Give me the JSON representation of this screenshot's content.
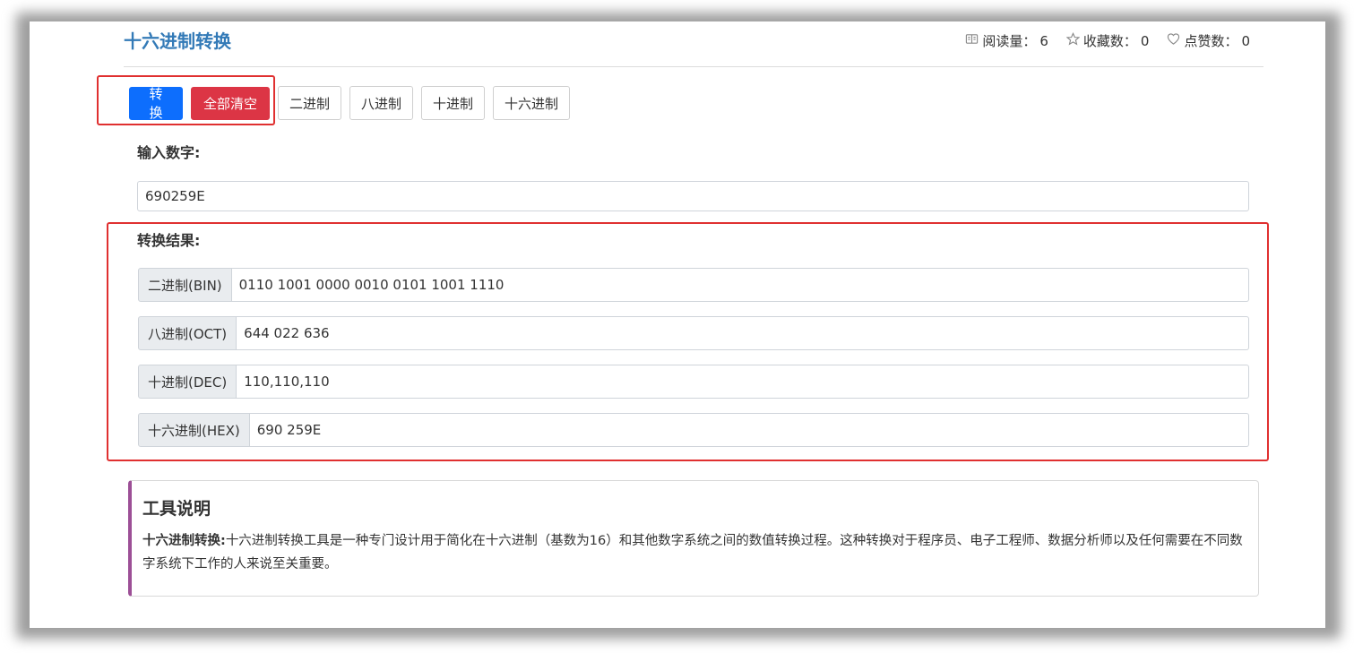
{
  "header": {
    "title": "十六进制转换",
    "stats": [
      {
        "icon": "book-icon",
        "label": "阅读量：",
        "value": "6"
      },
      {
        "icon": "star-icon",
        "label": "收藏数：",
        "value": "0"
      },
      {
        "icon": "heart-icon",
        "label": "点赞数：",
        "value": "0"
      }
    ]
  },
  "toolbar": {
    "convert_label": "转 换",
    "clear_label": "全部清空",
    "bin_label": "二进制",
    "oct_label": "八进制",
    "dec_label": "十进制",
    "hex_label": "十六进制"
  },
  "input": {
    "label": "输入数字:",
    "value": "690259E"
  },
  "results": {
    "label": "转换结果:",
    "rows": [
      {
        "addon": "二进制(BIN)",
        "value": "0110 1001 0000 0010 0101 1001 1110"
      },
      {
        "addon": "八进制(OCT)",
        "value": "644 022 636"
      },
      {
        "addon": "十进制(DEC)",
        "value": "110,110,110"
      },
      {
        "addon": "十六进制(HEX)",
        "value": "690 259E"
      }
    ]
  },
  "info": {
    "title": "工具说明",
    "lead": "十六进制转换:",
    "text": "十六进制转换工具是一种专门设计用于简化在十六进制（基数为16）和其他数字系统之间的数值转换过程。这种转换对于程序员、电子工程师、数据分析师以及任何需要在不同数字系统下工作的人来说至关重要。"
  },
  "colors": {
    "title_blue": "#337ab7",
    "primary": "#0d6efd",
    "danger": "#dc3545",
    "highlight_red": "#e03030",
    "info_accent": "#9c4f96"
  }
}
